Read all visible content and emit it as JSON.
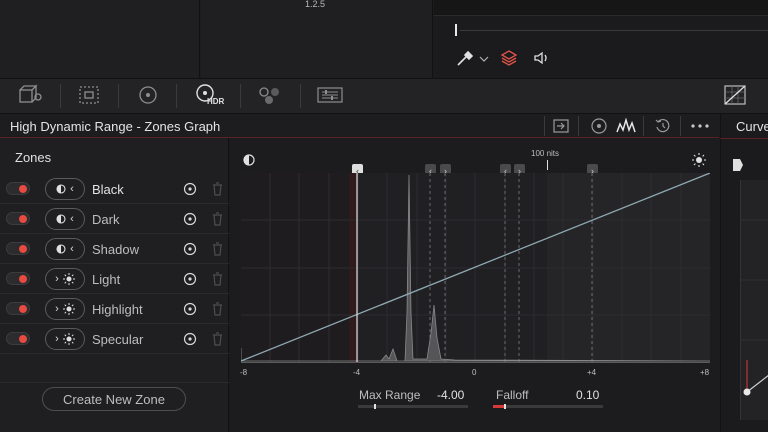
{
  "top": {
    "version": "1.2.5"
  },
  "panel": {
    "title": "High Dynamic Range - Zones Graph"
  },
  "right_panel": {
    "title": "Curve"
  },
  "zones": {
    "title": "Zones",
    "items": [
      {
        "label": "Black",
        "mode": "dark",
        "enabled": true
      },
      {
        "label": "Dark",
        "mode": "dark",
        "enabled": true
      },
      {
        "label": "Shadow",
        "mode": "dark",
        "enabled": true
      },
      {
        "label": "Light",
        "mode": "light",
        "enabled": true
      },
      {
        "label": "Highlight",
        "mode": "light",
        "enabled": true
      },
      {
        "label": "Specular",
        "mode": "light",
        "enabled": true
      }
    ],
    "create_button": "Create New Zone"
  },
  "toolbar": {
    "hdr_label": "HDR",
    "icons": [
      "camera-raw-icon",
      "grid-select-icon",
      "circle-target-icon",
      "hdr-icon",
      "color-dots-icon",
      "sliders-icon",
      "curves-grid-icon"
    ]
  },
  "graph": {
    "nits_marker": "100 nits",
    "axis_ticks": [
      "-8",
      "-4",
      "0",
      "+4",
      "+8"
    ],
    "x_range": [
      -8,
      8
    ]
  },
  "params": {
    "max_range_label": "Max Range",
    "max_range_value": "-4.00",
    "falloff_label": "Falloff",
    "falloff_value": "0.10"
  },
  "colors": {
    "accent_red": "#e64a40",
    "curve_line": "#8fa9b3"
  }
}
